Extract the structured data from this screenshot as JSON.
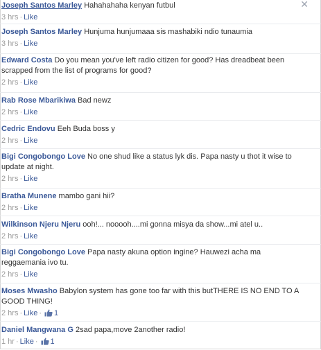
{
  "close_glyph": "✕",
  "separator": "·",
  "like_label": "Like",
  "comments": [
    {
      "author": "Joseph Santos Marley",
      "text": "Hahahahaha kenyan futbul",
      "time": "3 hrs",
      "likes": null
    },
    {
      "author": "Joseph Santos Marley",
      "text": "Hunjuma hunjumaaa sis mashabiki ndio tunaumia",
      "time": "3 hrs",
      "likes": null
    },
    {
      "author": "Edward Costa",
      "text": "Do you mean you've left radio citizen for good? Has dreadbeat been scrapped from the list of programs for good?",
      "time": "2 hrs",
      "likes": null
    },
    {
      "author": "Rab Rose Mbarikiwa",
      "text": "Bad newz",
      "time": "2 hrs",
      "likes": null
    },
    {
      "author": "Cedric Endovu",
      "text": "Eeh Buda boss y",
      "time": "2 hrs",
      "likes": null
    },
    {
      "author": "Bigi Congobongo Love",
      "text": "No one shud like a status lyk dis. Papa nasty u thot it wise to update at night.",
      "time": "2 hrs",
      "likes": null
    },
    {
      "author": "Bratha Munene",
      "text": "mambo gani hii?",
      "time": "2 hrs",
      "likes": null
    },
    {
      "author": "Wilkinson Njeru Njeru",
      "text": "ooh!... nooooh....mi gonna misya da show...mi atel u..",
      "time": "2 hrs",
      "likes": null
    },
    {
      "author": "Bigi Congobongo Love",
      "text": "Papa nasty akuna option ingine? Hauwezi acha ma reggaemania ivo tu.",
      "time": "2 hrs",
      "likes": null
    },
    {
      "author": "Moses Mwasho",
      "text": "Babylon system has gone too far with this butTHERE IS NO END TO A GOOD THING!",
      "time": "2 hrs",
      "likes": "1"
    },
    {
      "author": "Daniel Mangwana G",
      "text": "2sad papa,move 2another radio!",
      "time": "1 hr",
      "likes": "1"
    }
  ]
}
